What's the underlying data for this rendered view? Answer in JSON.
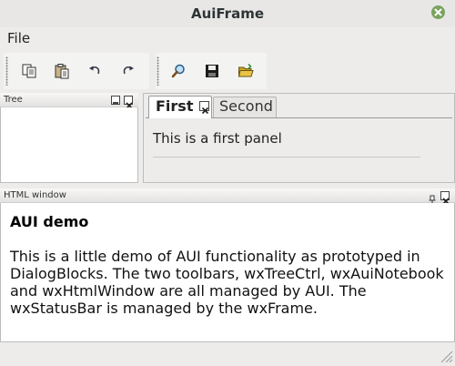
{
  "window": {
    "title": "AuiFrame"
  },
  "menu": {
    "file_label": "File"
  },
  "toolbar1": {
    "icons": [
      "copy-icon",
      "paste-icon",
      "undo-icon",
      "redo-icon"
    ]
  },
  "toolbar2": {
    "icons": [
      "find-icon",
      "save-icon",
      "open-folder-icon"
    ]
  },
  "tree_pane": {
    "caption": "Tree"
  },
  "notebook": {
    "tabs": [
      {
        "label": "First",
        "active": true
      },
      {
        "label": "Second",
        "active": false
      }
    ],
    "panel_text": "This is a first panel"
  },
  "html_pane": {
    "caption": "HTML window",
    "heading": "AUI demo",
    "paragraph": "This is a little demo of AUI functionality as prototyped in DialogBlocks. The two toolbars, wxTreeCtrl, wxAuiNotebook and wxHtmlWindow are all managed by AUI. The wxStatusBar is managed by the wxFrame."
  },
  "colors": {
    "close_button": "#7aa35f",
    "window_bg": "#edeceb"
  }
}
